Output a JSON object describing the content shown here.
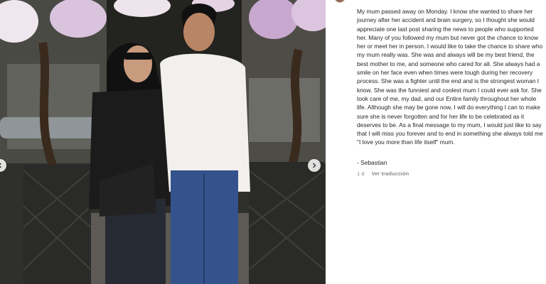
{
  "post": {
    "caption": "My mum passed away on Monday. I know she wanted to share her journey after her accident and brain surgery, so I thought she would appreciate one last post sharing the news to people who supported her. Many of you followed my mum but never got the chance to know her or meet her in person. I would like to take the chance to share who my mum really was. She was and always will be my best friend, the best mother to me, and someone who cared for all. She always had a smile on her face even when times were tough during her recovery process. She was a fighter until the end and is the strongest woman I know. She was the funniest and coolest mum I could ever ask for. She took care of me, my dad, and our Entire family throughout her whole life. Although she may be gone now, I will do everything I can to make sure she is never forgotten and for her life to be celebrated as it deserves to be. As a final message to my mum, I would just like to say that I will miss you forever and to end in something she always told me \"I love you more than life itself\" mum.",
    "signature": "- Sebastian",
    "time": "1 d",
    "translate_label": "Ver traducción"
  },
  "colors": {
    "text": "#262626",
    "meta": "#8e8e8e"
  },
  "icons": {
    "prev": "chevron-left-icon",
    "next": "chevron-right-icon"
  }
}
